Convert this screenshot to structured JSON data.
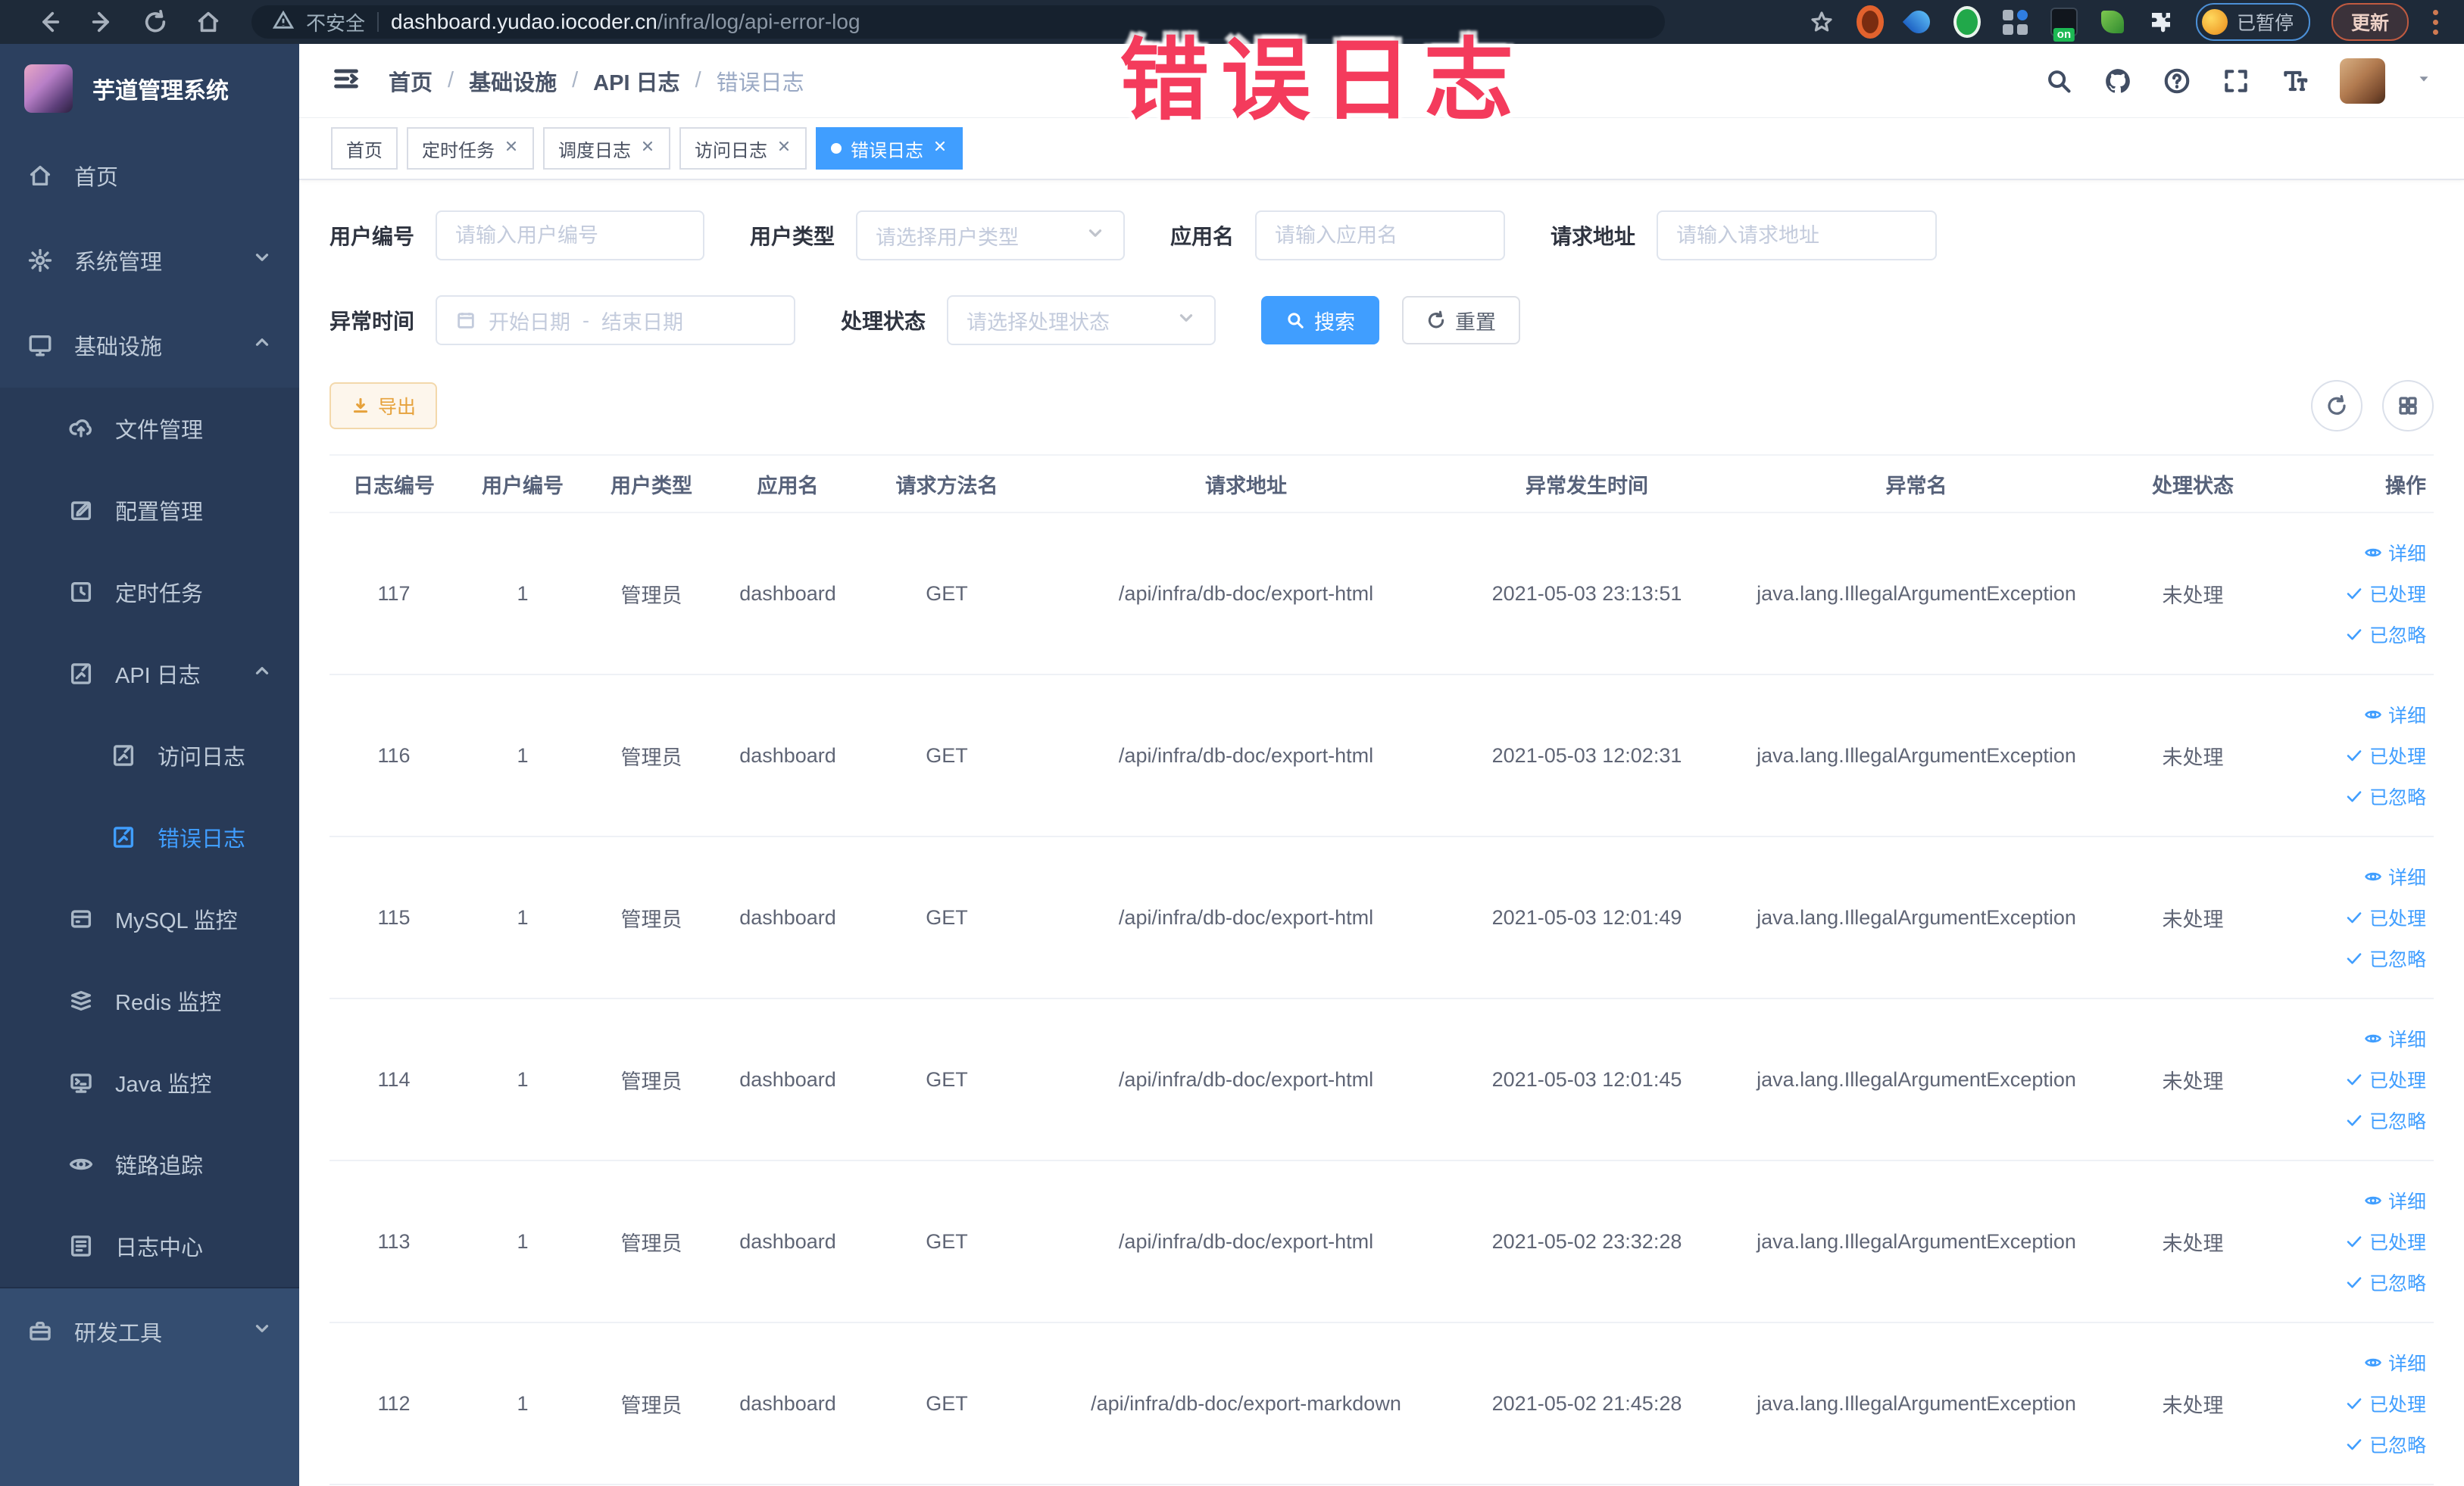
{
  "browser": {
    "security_label": "不安全",
    "url_host": "dashboard.yudao.iocoder.cn",
    "url_path": "/infra/log/api-error-log",
    "extension_badge": "on",
    "profile_status": "已暂停",
    "update_label": "更新"
  },
  "annotation": {
    "text": "错误日志",
    "color": "#f43b5c"
  },
  "sidebar": {
    "title": "芋道管理系统",
    "menu": [
      {
        "label": "首页"
      },
      {
        "label": "系统管理"
      },
      {
        "label": "基础设施"
      },
      {
        "label": "文件管理"
      },
      {
        "label": "配置管理"
      },
      {
        "label": "定时任务"
      },
      {
        "label": "API 日志"
      },
      {
        "label": "访问日志"
      },
      {
        "label": "错误日志"
      },
      {
        "label": "MySQL 监控"
      },
      {
        "label": "Redis 监控"
      },
      {
        "label": "Java 监控"
      },
      {
        "label": "链路追踪"
      },
      {
        "label": "日志中心"
      },
      {
        "label": "研发工具"
      }
    ]
  },
  "breadcrumb": {
    "separator": "/",
    "items": [
      "首页",
      "基础设施",
      "API 日志",
      "错误日志"
    ]
  },
  "tags": [
    {
      "label": "首页"
    },
    {
      "label": "定时任务"
    },
    {
      "label": "调度日志"
    },
    {
      "label": "访问日志"
    },
    {
      "label": "错误日志"
    }
  ],
  "filters": {
    "user_id": {
      "label": "用户编号",
      "placeholder": "请输入用户编号"
    },
    "user_type": {
      "label": "用户类型",
      "placeholder": "请选择用户类型"
    },
    "app_name": {
      "label": "应用名",
      "placeholder": "请输入应用名"
    },
    "request_url": {
      "label": "请求地址",
      "placeholder": "请输入请求地址"
    },
    "exception_time": {
      "label": "异常时间",
      "start_placeholder": "开始日期",
      "separator": "-",
      "end_placeholder": "结束日期"
    },
    "process_status": {
      "label": "处理状态",
      "placeholder": "请选择处理状态"
    },
    "search_label": "搜索",
    "reset_label": "重置"
  },
  "toolbar": {
    "export_label": "导出"
  },
  "table": {
    "columns": [
      "日志编号",
      "用户编号",
      "用户类型",
      "应用名",
      "请求方法名",
      "请求地址",
      "异常发生时间",
      "异常名",
      "处理状态",
      "操作"
    ],
    "actions": [
      "详细",
      "已处理",
      "已忽略"
    ],
    "rows": [
      {
        "id": "117",
        "user_id": "1",
        "user_type": "管理员",
        "app": "dashboard",
        "method": "GET",
        "url": "/api/infra/db-doc/export-html",
        "time": "2021-05-03 23:13:51",
        "exception": "java.lang.IllegalArgumentException",
        "status": "未处理"
      },
      {
        "id": "116",
        "user_id": "1",
        "user_type": "管理员",
        "app": "dashboard",
        "method": "GET",
        "url": "/api/infra/db-doc/export-html",
        "time": "2021-05-03 12:02:31",
        "exception": "java.lang.IllegalArgumentException",
        "status": "未处理"
      },
      {
        "id": "115",
        "user_id": "1",
        "user_type": "管理员",
        "app": "dashboard",
        "method": "GET",
        "url": "/api/infra/db-doc/export-html",
        "time": "2021-05-03 12:01:49",
        "exception": "java.lang.IllegalArgumentException",
        "status": "未处理"
      },
      {
        "id": "114",
        "user_id": "1",
        "user_type": "管理员",
        "app": "dashboard",
        "method": "GET",
        "url": "/api/infra/db-doc/export-html",
        "time": "2021-05-03 12:01:45",
        "exception": "java.lang.IllegalArgumentException",
        "status": "未处理"
      },
      {
        "id": "113",
        "user_id": "1",
        "user_type": "管理员",
        "app": "dashboard",
        "method": "GET",
        "url": "/api/infra/db-doc/export-html",
        "time": "2021-05-02 23:32:28",
        "exception": "java.lang.IllegalArgumentException",
        "status": "未处理"
      },
      {
        "id": "112",
        "user_id": "1",
        "user_type": "管理员",
        "app": "dashboard",
        "method": "GET",
        "url": "/api/infra/db-doc/export-markdown",
        "time": "2021-05-02 21:45:28",
        "exception": "java.lang.IllegalArgumentException",
        "status": "未处理"
      }
    ]
  },
  "colors": {
    "accent": "#409eff",
    "warning": "#e6a23c",
    "annotation": "#f43b5c",
    "sidebar_bg": "#2c405f"
  }
}
